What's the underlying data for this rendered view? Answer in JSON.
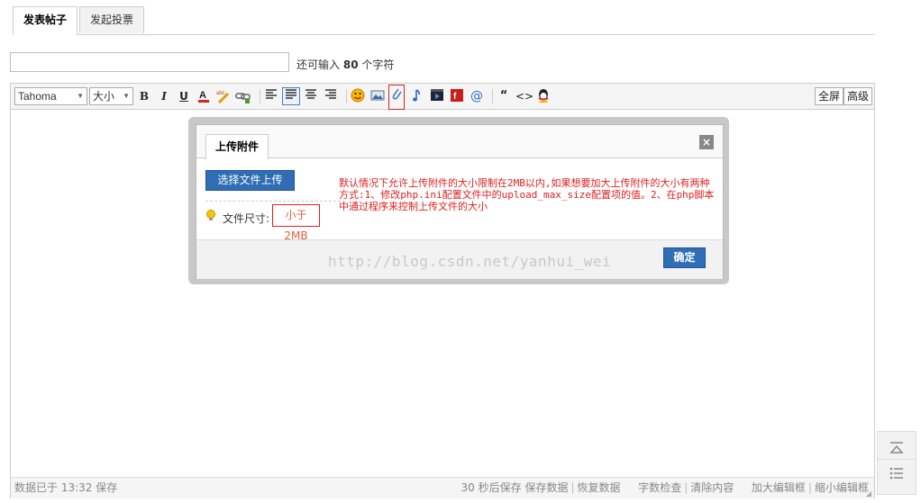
{
  "tabs": [
    {
      "label": "发表帖子",
      "active": true
    },
    {
      "label": "发起投票",
      "active": false
    }
  ],
  "subject": {
    "value": "",
    "remaining_prefix": "还可输入",
    "remaining_count": "80",
    "remaining_suffix": "个字符"
  },
  "toolbar": {
    "font_select": "Tahoma",
    "size_select": "大小",
    "bold": "B",
    "italic": "I",
    "underline": "U",
    "fullscreen_label": "全屏",
    "advanced_label": "高级"
  },
  "dialog": {
    "tab_label": "上传附件",
    "close": "×",
    "upload_button": "选择文件上传",
    "size_label": "文件尺寸:",
    "size_value": "小于 2MB",
    "annotation": "默认情况下允许上传附件的大小限制在2MB以内,如果想要加大上传附件的大小有两种方式:1、修改php.ini配置文件中的upload_max_size配置项的值。2、在php脚本中通过程序来控制上传文件的大小",
    "watermark": "http://blog.csdn.net/yanhui_wei",
    "confirm_button": "确定"
  },
  "status": {
    "saved_text": "数据已于 13:32 保存",
    "autosave": "30 秒后保存",
    "save_data": "保存数据",
    "restore_data": "恢复数据",
    "word_check": "字数检查",
    "clear_content": "清除内容",
    "enlarge_editor": "加大编辑框",
    "shrink_editor": "缩小编辑框"
  },
  "colors": {
    "primary_button": "#2f6db5",
    "annotation_red": "#e02020"
  }
}
